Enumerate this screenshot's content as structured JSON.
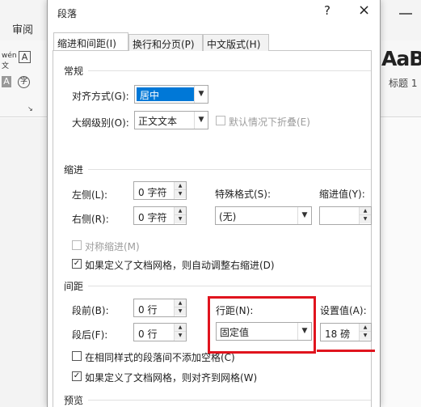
{
  "background": {
    "ribbon_tab": "审阅",
    "style_preview": "AaB",
    "style_label": "标题 1"
  },
  "dialog": {
    "title": "段落",
    "help": "?",
    "close": "×",
    "tabs": [
      {
        "label": "缩进和间距(I)",
        "active": true
      },
      {
        "label": "换行和分页(P)",
        "active": false
      },
      {
        "label": "中文版式(H)",
        "active": false
      }
    ],
    "general": {
      "heading": "常规",
      "alignment_label": "对齐方式(G):",
      "alignment_value": "居中",
      "outline_label": "大纲级别(O):",
      "outline_value": "正文文本",
      "collapsed_label": "默认情况下折叠(E)"
    },
    "indent": {
      "heading": "缩进",
      "left_label": "左侧(L):",
      "left_value": "0 字符",
      "right_label": "右侧(R):",
      "right_value": "0 字符",
      "special_label": "特殊格式(S):",
      "special_value": "(无)",
      "indent_by_label": "缩进值(Y):",
      "indent_by_value": "",
      "mirror_label": "对称缩进(M)",
      "grid_adjust_label": "如果定义了文档网格，则自动调整右缩进(D)"
    },
    "spacing": {
      "heading": "间距",
      "before_label": "段前(B):",
      "before_value": "0 行",
      "after_label": "段后(F):",
      "after_value": "0 行",
      "line_spacing_label": "行距(N):",
      "line_spacing_value": "固定值",
      "at_label": "设置值(A):",
      "at_value": "18 磅",
      "no_space_same_style_label": "在相同样式的段落间不添加空格(C)",
      "snap_to_grid_label": "如果定义了文档网格，则对齐到网格(W)"
    },
    "preview": {
      "heading": "预览"
    }
  },
  "colors": {
    "selection": "#0078d7",
    "highlight": "#e0141e"
  }
}
